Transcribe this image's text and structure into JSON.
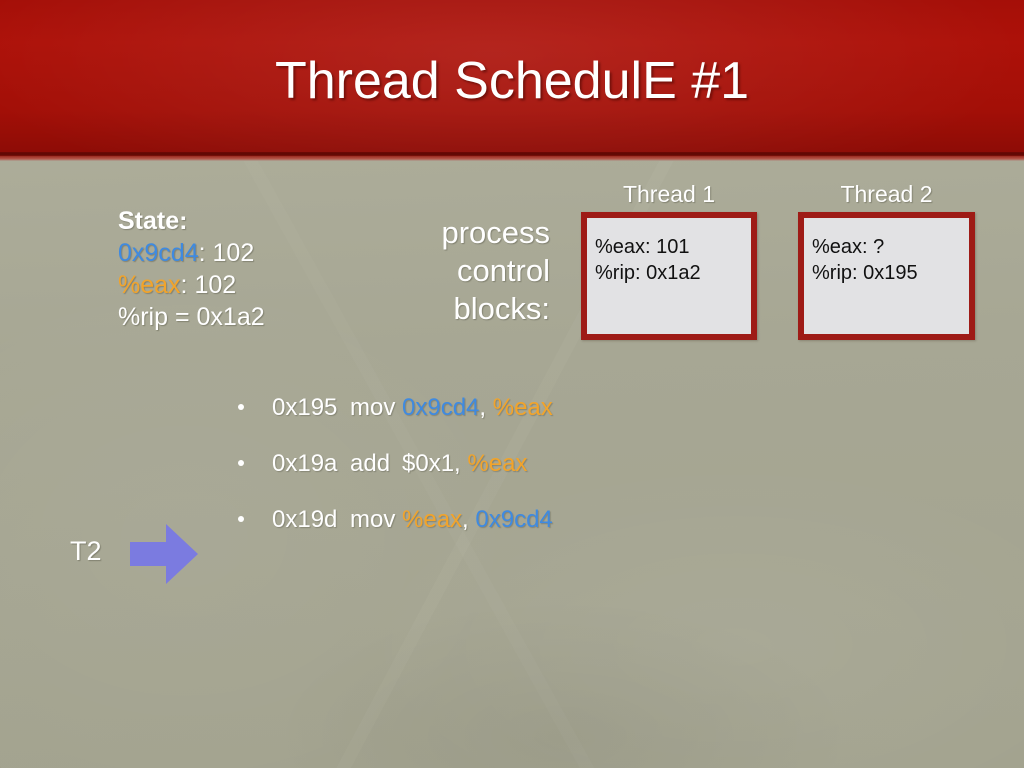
{
  "slide": {
    "title": "Thread SchedulE #1",
    "colors": {
      "header_red": "#a50f08",
      "background": "#a9a996",
      "accent_blue": "#3f8ae0",
      "accent_orange": "#f2a42b",
      "box_border": "#9e1b16",
      "box_fill": "#e2e2e4",
      "arrow_purple": "#7b7be0"
    }
  },
  "state": {
    "heading": "State:",
    "rows": [
      {
        "name": "0x9cd4",
        "name_color": "blue",
        "sep": ": ",
        "value": "102"
      },
      {
        "name": "%eax",
        "name_color": "orange",
        "sep": ": ",
        "value": "102"
      },
      {
        "name": "%rip",
        "name_color": "white",
        "sep": " = ",
        "value": "0x1a2"
      }
    ]
  },
  "pcb": {
    "label_line1": "process",
    "label_line2": "control",
    "label_line3": "blocks:"
  },
  "threads": [
    {
      "title": "Thread 1",
      "eax_line": "%eax: 101",
      "rip_line": "%rip: 0x1a2"
    },
    {
      "title": "Thread 2",
      "eax_line": "%eax: ?",
      "rip_line": "%rip: 0x195"
    }
  ],
  "instructions": [
    {
      "address": "0x195",
      "mnemonic": "mov",
      "operand1": "0x9cd4",
      "operand1_color": "blue",
      "separator": ", ",
      "operand2": "%eax",
      "operand2_color": "orange"
    },
    {
      "address": "0x19a",
      "mnemonic": "add",
      "operand1": "$0x1",
      "operand1_color": "white",
      "separator": ", ",
      "operand2": "%eax",
      "operand2_color": "orange"
    },
    {
      "address": "0x19d",
      "mnemonic": "mov",
      "operand1": "%eax",
      "operand1_color": "orange",
      "separator": ", ",
      "operand2": "0x9cd4",
      "operand2_color": "blue"
    }
  ],
  "marker": {
    "label": "T2",
    "arrow_icon": "right-arrow-icon"
  }
}
